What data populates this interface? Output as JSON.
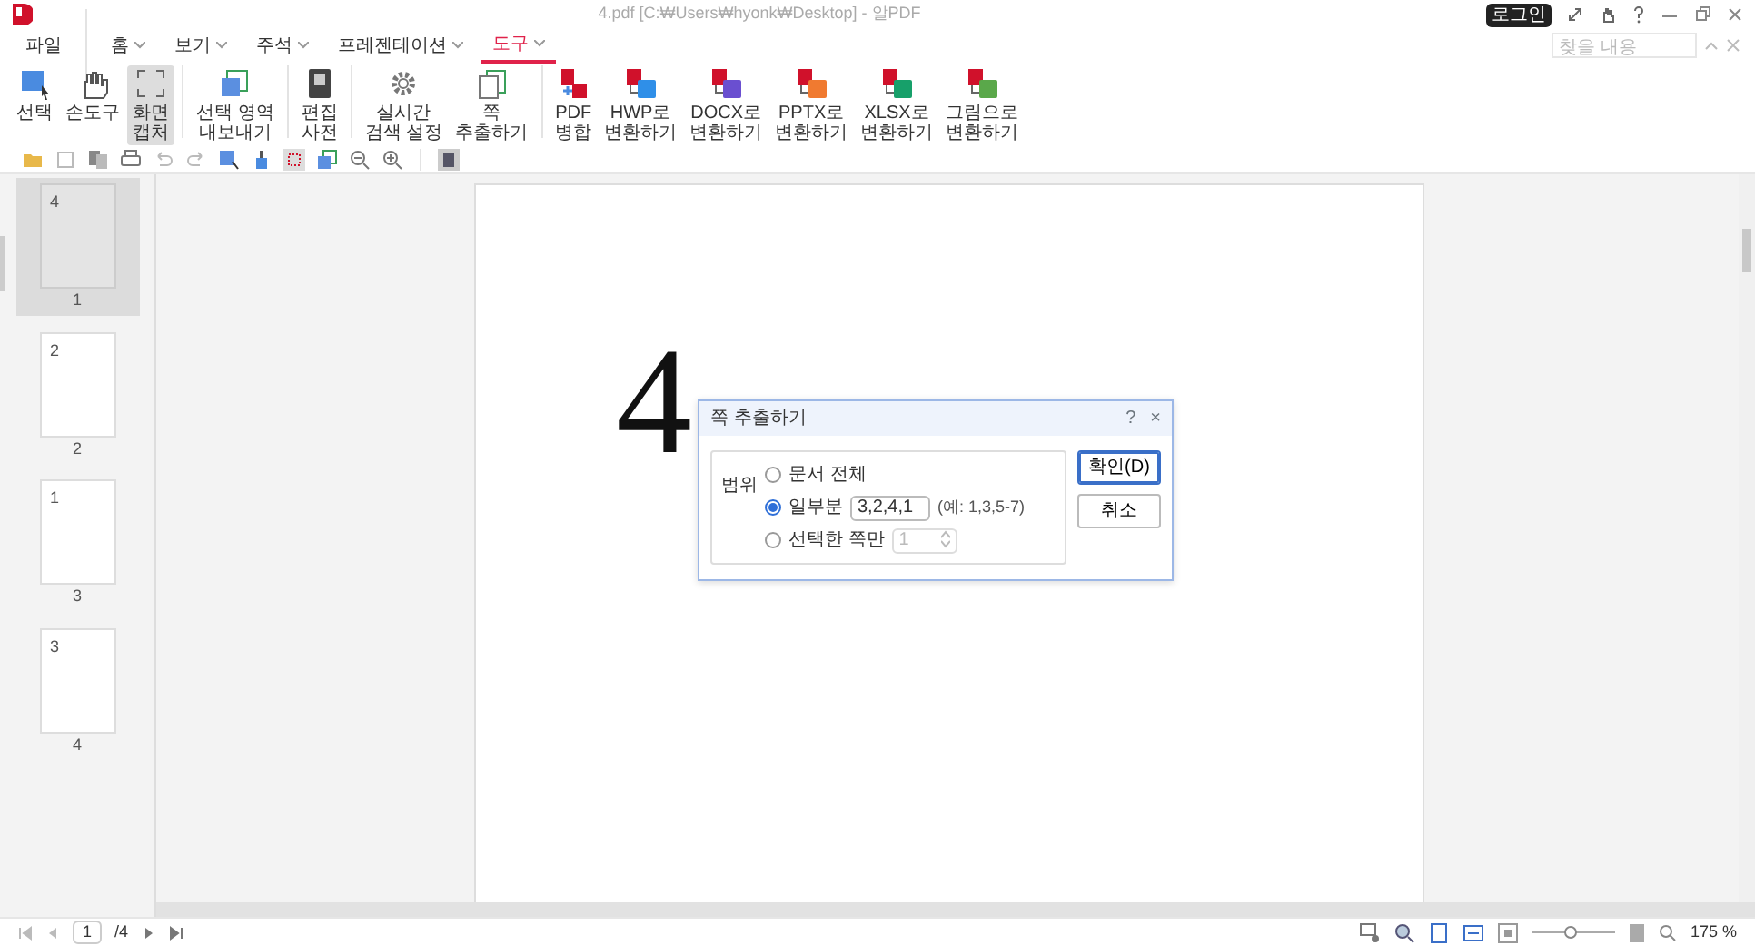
{
  "window": {
    "title": "4.pdf [C:₩Users₩hyonk₩Desktop] - 알PDF",
    "login": "로그인"
  },
  "menu": [
    {
      "label": "파일",
      "dropdown": false,
      "selected": false
    },
    {
      "label": "홈",
      "dropdown": true,
      "selected": false
    },
    {
      "label": "보기",
      "dropdown": true,
      "selected": false
    },
    {
      "label": "주석",
      "dropdown": true,
      "selected": false
    },
    {
      "label": "프레젠테이션",
      "dropdown": true,
      "selected": false
    },
    {
      "label": "도구",
      "dropdown": true,
      "selected": true
    }
  ],
  "find": {
    "placeholder": "찾을 내용"
  },
  "ribbon": [
    {
      "kind": "select",
      "label": "선택",
      "selected": false
    },
    {
      "kind": "hand",
      "label": "손도구",
      "selected": false
    },
    {
      "kind": "capture",
      "label": "화면\n캡처",
      "selected": true
    },
    {
      "kind": "export",
      "label": "선택 영역\n내보내기",
      "selected": false
    },
    {
      "kind": "dict",
      "label": "편집\n사전",
      "selected": false
    },
    {
      "kind": "gear",
      "label": "실시간\n검색 설정",
      "selected": false
    },
    {
      "kind": "extract",
      "label": "쪽\n추출하기",
      "selected": false
    },
    {
      "kind": "merge",
      "label": "PDF\n병합",
      "selected": false
    },
    {
      "kind": "convert",
      "label": "HWP로\n변환하기",
      "color": "#2f8fe8",
      "selected": false
    },
    {
      "kind": "convert",
      "label": "DOCX로\n변환하기",
      "color": "#6a4fd0",
      "selected": false
    },
    {
      "kind": "convert",
      "label": "PPTX로\n변환하기",
      "color": "#f07a30",
      "selected": false
    },
    {
      "kind": "convert",
      "label": "XLSX로\n변환하기",
      "color": "#17a06a",
      "selected": false
    },
    {
      "kind": "convert",
      "label": "그림으로\n변환하기",
      "color": "#5aa84a",
      "selected": false
    }
  ],
  "thumbnails": [
    {
      "content": "4",
      "label": "1",
      "selected": true
    },
    {
      "content": "2",
      "label": "2",
      "selected": false
    },
    {
      "content": "1",
      "label": "3",
      "selected": false
    },
    {
      "content": "3",
      "label": "4",
      "selected": false
    }
  ],
  "page": {
    "content": "4"
  },
  "dialog": {
    "title": "쪽 추출하기",
    "help": "?",
    "close": "×",
    "group_label": "범위",
    "options": [
      {
        "kind": "plain",
        "label": "문서 전체",
        "selected": false
      },
      {
        "kind": "field",
        "label": "일부분",
        "selected": true,
        "value": "3,2,4,1",
        "hint": "(예: 1,3,5-7)"
      },
      {
        "kind": "spin",
        "label": "선택한 쪽만",
        "selected": false,
        "value": "1"
      }
    ],
    "buttons": [
      {
        "label": "확인(D)",
        "default": true
      },
      {
        "label": "취소",
        "default": false
      }
    ]
  },
  "status": {
    "page": "1",
    "total": "/4",
    "zoom": "175 %",
    "zoom_slider": {
      "level": 0.45
    }
  }
}
